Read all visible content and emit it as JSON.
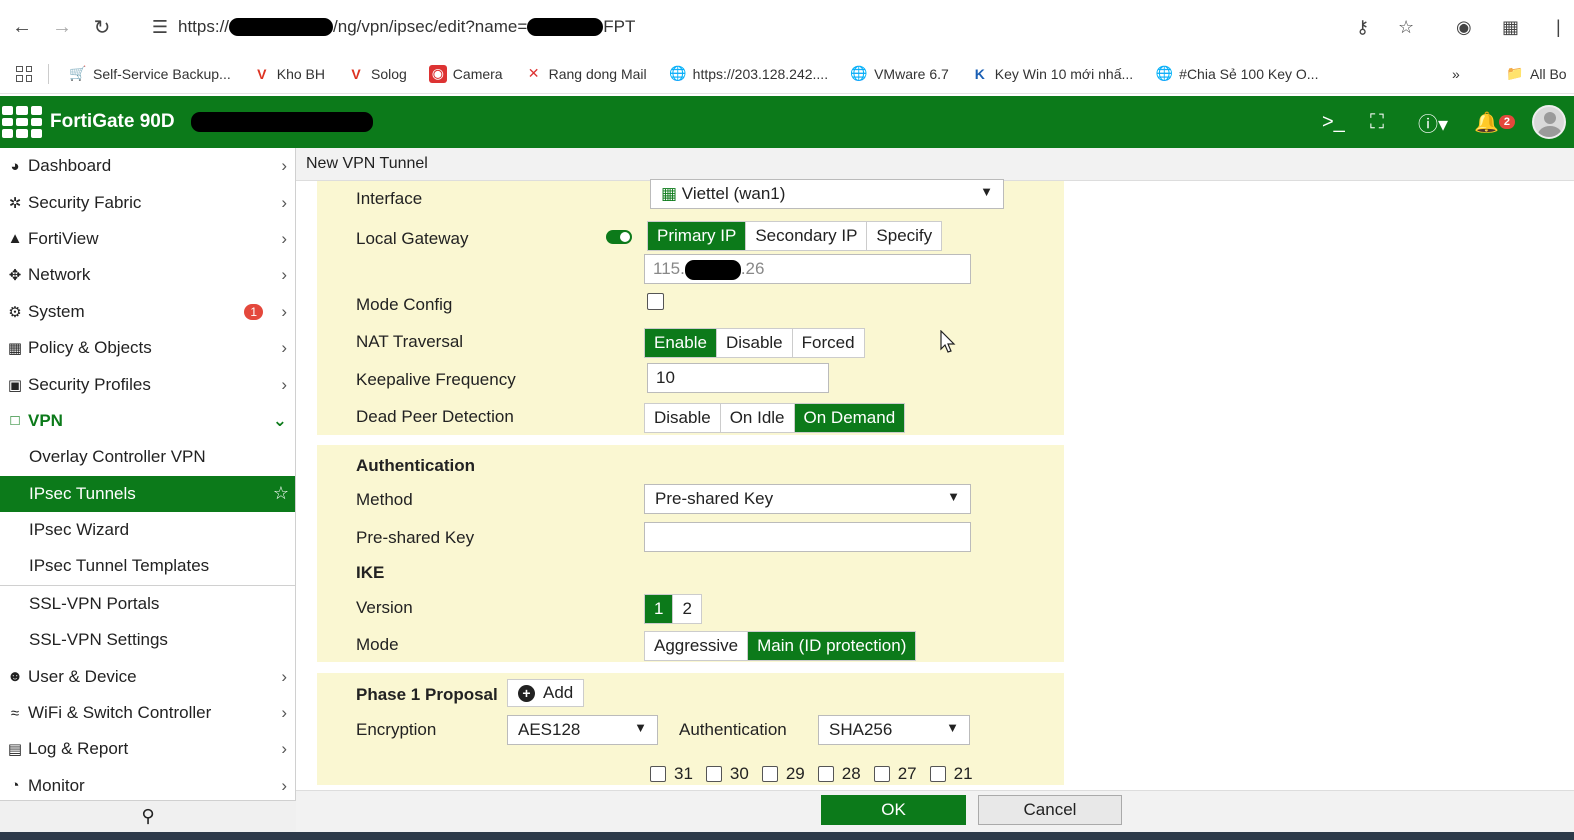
{
  "browser": {
    "url_prefix": "https://",
    "url_middle": "/ng/vpn/ipsec/edit?name=",
    "url_suffix": "FPT",
    "bookmarks": [
      {
        "label": "Self-Service Backup...",
        "icon": "cart-icon"
      },
      {
        "label": "Kho BH",
        "icon": "v-logo-icon"
      },
      {
        "label": "Solog",
        "icon": "v-logo-icon"
      },
      {
        "label": "Camera",
        "icon": "camera-icon"
      },
      {
        "label": "Rang dong Mail",
        "icon": "mail-icon"
      },
      {
        "label": "https://203.128.242....",
        "icon": "globe-icon"
      },
      {
        "label": "VMware 6.7",
        "icon": "globe-icon"
      },
      {
        "label": "Key Win 10 mới nhấ...",
        "icon": "k-logo-icon"
      },
      {
        "label": "#Chia Sẻ 100 Key O...",
        "icon": "globe-icon"
      }
    ],
    "more_label": "»",
    "all_bookmarks_label": "All Bo"
  },
  "header": {
    "title": "FortiGate 90D",
    "notification_count": "2"
  },
  "sidebar": {
    "items": [
      {
        "label": "Dashboard",
        "icon": "dashboard-icon"
      },
      {
        "label": "Security Fabric",
        "icon": "fabric-icon"
      },
      {
        "label": "FortiView",
        "icon": "chart-icon"
      },
      {
        "label": "Network",
        "icon": "network-icon"
      },
      {
        "label": "System",
        "icon": "gear-icon",
        "badge": "1"
      },
      {
        "label": "Policy & Objects",
        "icon": "policy-icon"
      },
      {
        "label": "Security Profiles",
        "icon": "lock-icon"
      },
      {
        "label": "VPN",
        "icon": "laptop-icon"
      }
    ],
    "vpn_sub": [
      "Overlay Controller VPN",
      "IPsec Tunnels",
      "IPsec Wizard",
      "IPsec Tunnel Templates",
      "SSL-VPN Portals",
      "SSL-VPN Settings"
    ],
    "items_after": [
      {
        "label": "User & Device",
        "icon": "user-icon"
      },
      {
        "label": "WiFi & Switch Controller",
        "icon": "wifi-icon"
      },
      {
        "label": "Log & Report",
        "icon": "report-icon"
      },
      {
        "label": "Monitor",
        "icon": "monitor-icon"
      }
    ]
  },
  "page": {
    "title": "New VPN Tunnel"
  },
  "network": {
    "interface_label": "Interface",
    "interface_value": "Viettel (wan1)",
    "local_gateway_label": "Local Gateway",
    "local_gateway_options": [
      "Primary IP",
      "Secondary IP",
      "Specify"
    ],
    "local_gateway_ip_start": "115.",
    "local_gateway_ip_end": ".26",
    "mode_config_label": "Mode Config",
    "nat_traversal_label": "NAT Traversal",
    "nat_traversal_options": [
      "Enable",
      "Disable",
      "Forced"
    ],
    "keepalive_label": "Keepalive Frequency",
    "keepalive_value": "10",
    "dpd_label": "Dead Peer Detection",
    "dpd_options": [
      "Disable",
      "On Idle",
      "On Demand"
    ]
  },
  "authentication": {
    "heading": "Authentication",
    "method_label": "Method",
    "method_value": "Pre-shared Key",
    "psk_label": "Pre-shared Key",
    "psk_value": "",
    "ike_heading": "IKE",
    "version_label": "Version",
    "version_options": [
      "1",
      "2"
    ],
    "mode_label": "Mode",
    "mode_options": [
      "Aggressive",
      "Main (ID protection)"
    ]
  },
  "phase1": {
    "heading": "Phase 1 Proposal",
    "add_label": "Add",
    "encryption_label": "Encryption",
    "encryption_value": "AES128",
    "auth_label": "Authentication",
    "auth_value": "SHA256",
    "dh_groups": [
      "31",
      "30",
      "29",
      "28",
      "27",
      "21"
    ]
  },
  "footer": {
    "ok_label": "OK",
    "cancel_label": "Cancel"
  }
}
